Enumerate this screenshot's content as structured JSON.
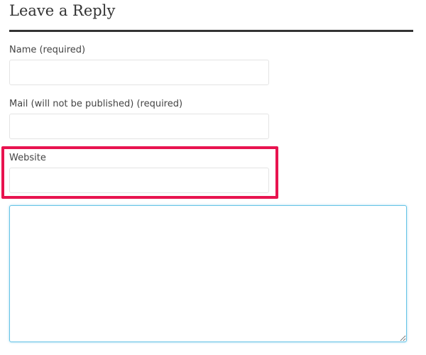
{
  "reply": {
    "title": "Leave a Reply",
    "name_field": {
      "label": "Name (required)",
      "value": "",
      "placeholder": ""
    },
    "mail_field": {
      "label": "Mail (will not be published) (required)",
      "value": "",
      "placeholder": ""
    },
    "website_field": {
      "label": "Website",
      "value": "",
      "placeholder": ""
    },
    "comment_field": {
      "value": "",
      "placeholder": ""
    }
  },
  "colors": {
    "heading_rule": "#333333",
    "highlight_border": "#e8134f",
    "focus_border": "#66c3e6",
    "input_border": "#e4e4e4"
  }
}
